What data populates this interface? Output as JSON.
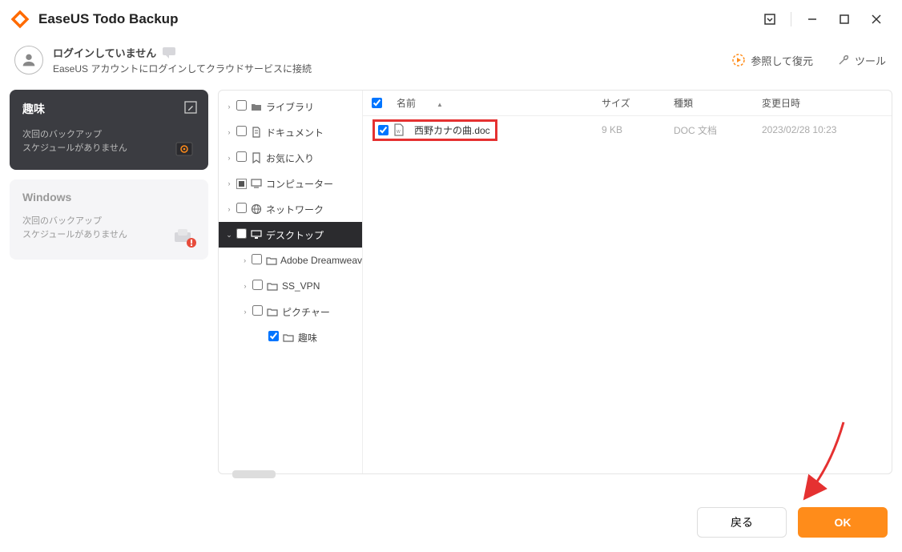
{
  "app": {
    "title": "EaseUS Todo Backup"
  },
  "login": {
    "status": "ログインしていません",
    "hint": "EaseUS アカウントにログインしてクラウドサービスに接続"
  },
  "toolbar": {
    "browse_restore": "参照して復元",
    "tools": "ツール"
  },
  "cards": [
    {
      "title": "趣味",
      "sub1": "次回のバックアップ",
      "sub2": "スケジュールがありません"
    },
    {
      "title": "Windows",
      "sub1": "次回のバックアップ",
      "sub2": "スケジュールがありません"
    }
  ],
  "tree": [
    {
      "label": "ライブラリ",
      "depth": 0,
      "check": "empty",
      "expandable": true,
      "expanded": false,
      "icon": "folder"
    },
    {
      "label": "ドキュメント",
      "depth": 0,
      "check": "empty",
      "expandable": true,
      "expanded": false,
      "icon": "doc"
    },
    {
      "label": "お気に入り",
      "depth": 0,
      "check": "empty",
      "expandable": true,
      "expanded": false,
      "icon": "fav"
    },
    {
      "label": "コンピューター",
      "depth": 0,
      "check": "partial",
      "expandable": true,
      "expanded": false,
      "icon": "computer"
    },
    {
      "label": "ネットワーク",
      "depth": 0,
      "check": "empty",
      "expandable": true,
      "expanded": false,
      "icon": "network"
    },
    {
      "label": "デスクトップ",
      "depth": 0,
      "check": "empty",
      "expandable": true,
      "expanded": true,
      "icon": "desktop",
      "active": true
    },
    {
      "label": "Adobe Dreamweav",
      "depth": 1,
      "check": "empty",
      "expandable": true,
      "expanded": false,
      "icon": "folder-o"
    },
    {
      "label": "SS_VPN",
      "depth": 1,
      "check": "empty",
      "expandable": true,
      "expanded": false,
      "icon": "folder-o"
    },
    {
      "label": "ピクチャー",
      "depth": 1,
      "check": "empty",
      "expandable": true,
      "expanded": false,
      "icon": "folder-o"
    },
    {
      "label": "趣味",
      "depth": 2,
      "check": "checked",
      "expandable": false,
      "expanded": false,
      "icon": "folder-o"
    }
  ],
  "filelist": {
    "headers": {
      "name": "名前",
      "size": "サイズ",
      "type": "種類",
      "date": "変更日時"
    },
    "rows": [
      {
        "name": "西野カナの曲.doc",
        "size": "9 KB",
        "type": "DOC 文档",
        "date": "2023/02/28 10:23",
        "checked": true,
        "highlight": true
      }
    ]
  },
  "footer": {
    "back": "戻る",
    "ok": "OK"
  }
}
